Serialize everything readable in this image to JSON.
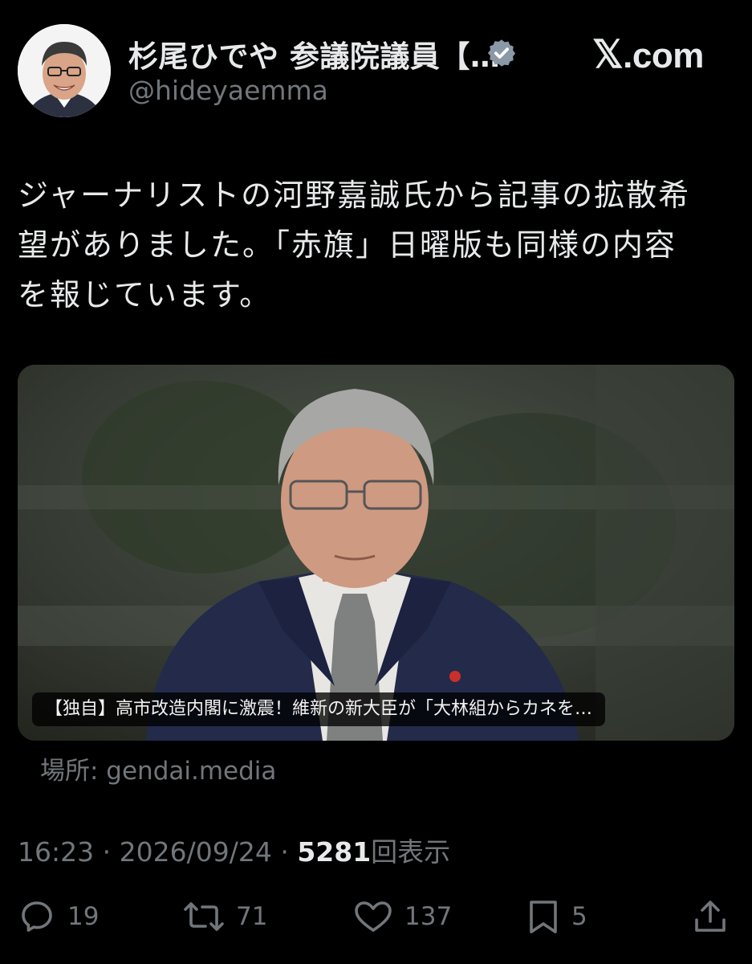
{
  "header": {
    "display_name": "杉尾ひでや 参議院議員【…",
    "handle": "@hideyaemma",
    "site_brand_mark": "𝕏",
    "site_brand_suffix": ".com"
  },
  "tweet": {
    "text_line1": "ジャーナリストの河野嘉誠氏から記事の拡散希",
    "text_line2": "望がありました。「赤旗」日曜版も同様の内容",
    "text_line3": "を報じています。"
  },
  "card": {
    "caption": "【独自】高市改造内閣に激震！維新の新大臣が「大林組からカネを…",
    "source": "場所: gendai.media"
  },
  "meta": {
    "time": "16:23",
    "separator": "·",
    "date": "2026/09/24",
    "views_count": "5281",
    "views_label": "回表示"
  },
  "actions": {
    "replies": "19",
    "reposts": "71",
    "likes": "137",
    "bookmarks": "5"
  },
  "colors": {
    "background": "#000000",
    "primary_text": "#e7e9ea",
    "secondary_text": "#71767b"
  },
  "icons": [
    "verified-badge-icon",
    "reply-icon",
    "repost-icon",
    "like-icon",
    "bookmark-icon",
    "share-icon"
  ]
}
